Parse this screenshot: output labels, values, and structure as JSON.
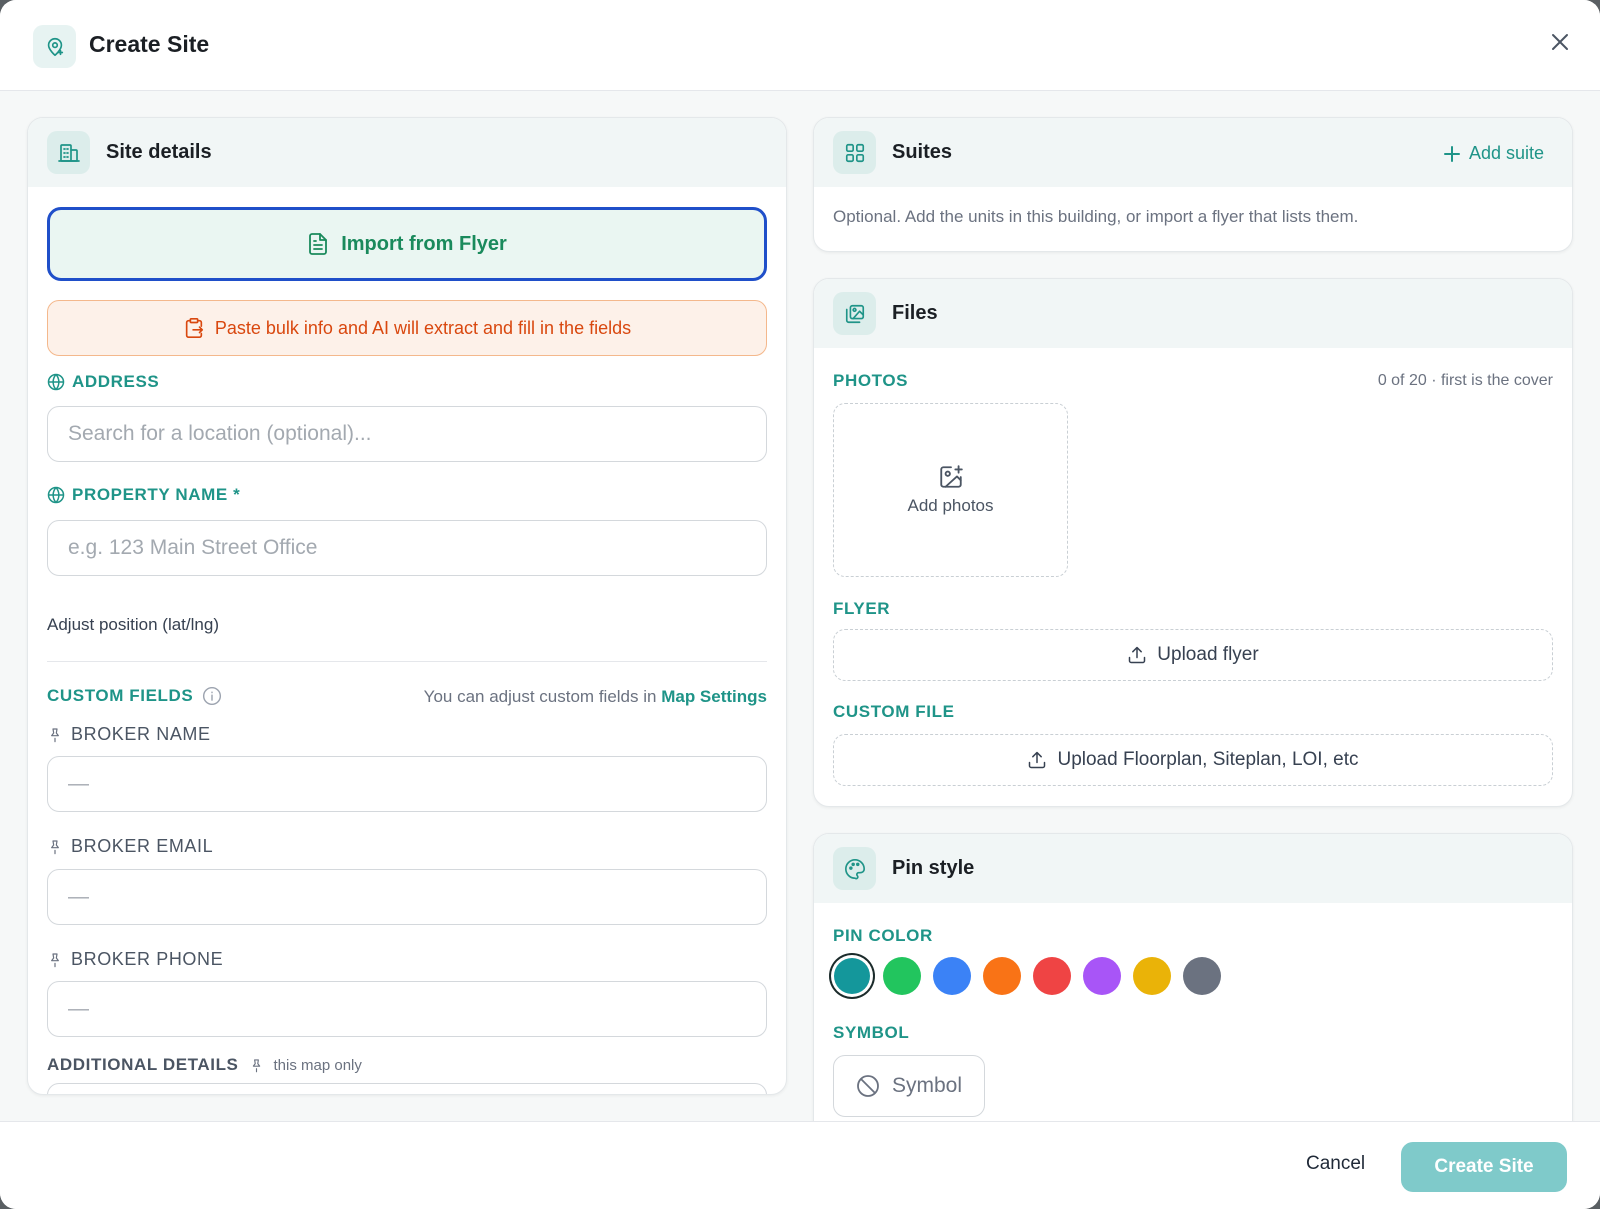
{
  "header": {
    "title": "Create Site"
  },
  "site_details": {
    "title": "Site details",
    "import_label": "Import from Flyer",
    "paste_label": "Paste bulk info and AI will extract and fill in the fields",
    "address_label": "ADDRESS",
    "address_placeholder": "Search for a location (optional)...",
    "property_label": "PROPERTY NAME *",
    "property_placeholder": "e.g. 123 Main Street Office",
    "adjust_label": "Adjust position (lat/lng)",
    "custom_fields_label": "CUSTOM FIELDS",
    "custom_fields_hint": "You can adjust custom fields in",
    "map_settings_link": "Map Settings",
    "broker_name_label": "BROKER NAME",
    "broker_email_label": "BROKER EMAIL",
    "broker_phone_label": "BROKER PHONE",
    "empty_placeholder": "—",
    "additional_label": "ADDITIONAL DETAILS",
    "additional_hint": "this map only"
  },
  "suites": {
    "title": "Suites",
    "add_label": "Add suite",
    "description": "Optional. Add the units in this building, or import a flyer that lists them."
  },
  "files": {
    "title": "Files",
    "photos_label": "PHOTOS",
    "photos_count": "0 of 20 · first is the cover",
    "add_photos": "Add photos",
    "flyer_label": "FLYER",
    "upload_flyer": "Upload flyer",
    "custom_file_label": "CUSTOM FILE",
    "upload_custom": "Upload Floorplan, Siteplan, LOI, etc"
  },
  "pin_style": {
    "title": "Pin style",
    "color_label": "PIN COLOR",
    "colors": [
      "#14979b",
      "#22c55e",
      "#3b82f6",
      "#f97316",
      "#ef4444",
      "#a855f7",
      "#eab308",
      "#6b7280"
    ],
    "selected_color": "#14979b",
    "symbol_label": "SYMBOL",
    "symbol_button": "Symbol"
  },
  "footer": {
    "cancel_label": "Cancel",
    "create_label": "Create Site"
  },
  "colors": {
    "accent": "#1f9488",
    "primary_button": "#7fcaca",
    "import_border": "#1f4fc9",
    "paste_text": "#d9480f"
  }
}
